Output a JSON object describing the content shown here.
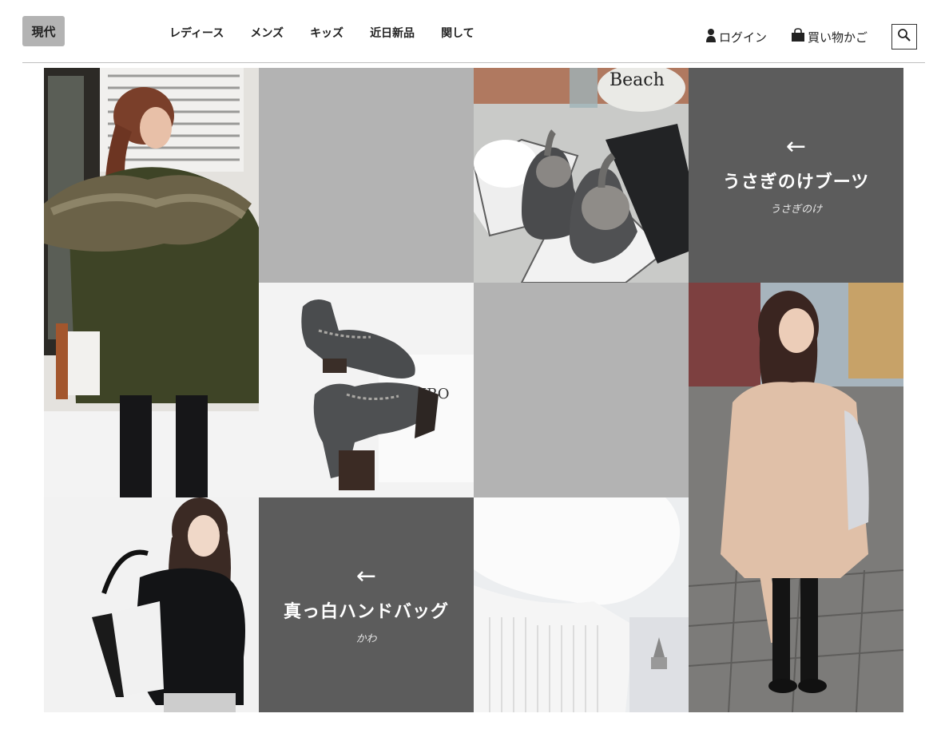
{
  "header": {
    "logo": "現代",
    "nav": [
      "レディース",
      "メンズ",
      "キッズ",
      "近日新品",
      "関して"
    ],
    "login_label": "ログイン",
    "cart_label": "買い物かご",
    "search_icon": "search-icon"
  },
  "photo_text": {
    "bucket_label": "Beach",
    "book_label": "URO"
  },
  "promos": [
    {
      "arrow": "←",
      "title": "うさぎのけブーツ",
      "subtitle": "うさぎのけ"
    },
    {
      "arrow": "←",
      "title": "真っ白ハンドバッグ",
      "subtitle": "かわ"
    }
  ],
  "colors": {
    "placeholder_gray": "#b3b3b3",
    "promo_dark": "#5c5c5c",
    "rule": "#bfbfbf"
  }
}
